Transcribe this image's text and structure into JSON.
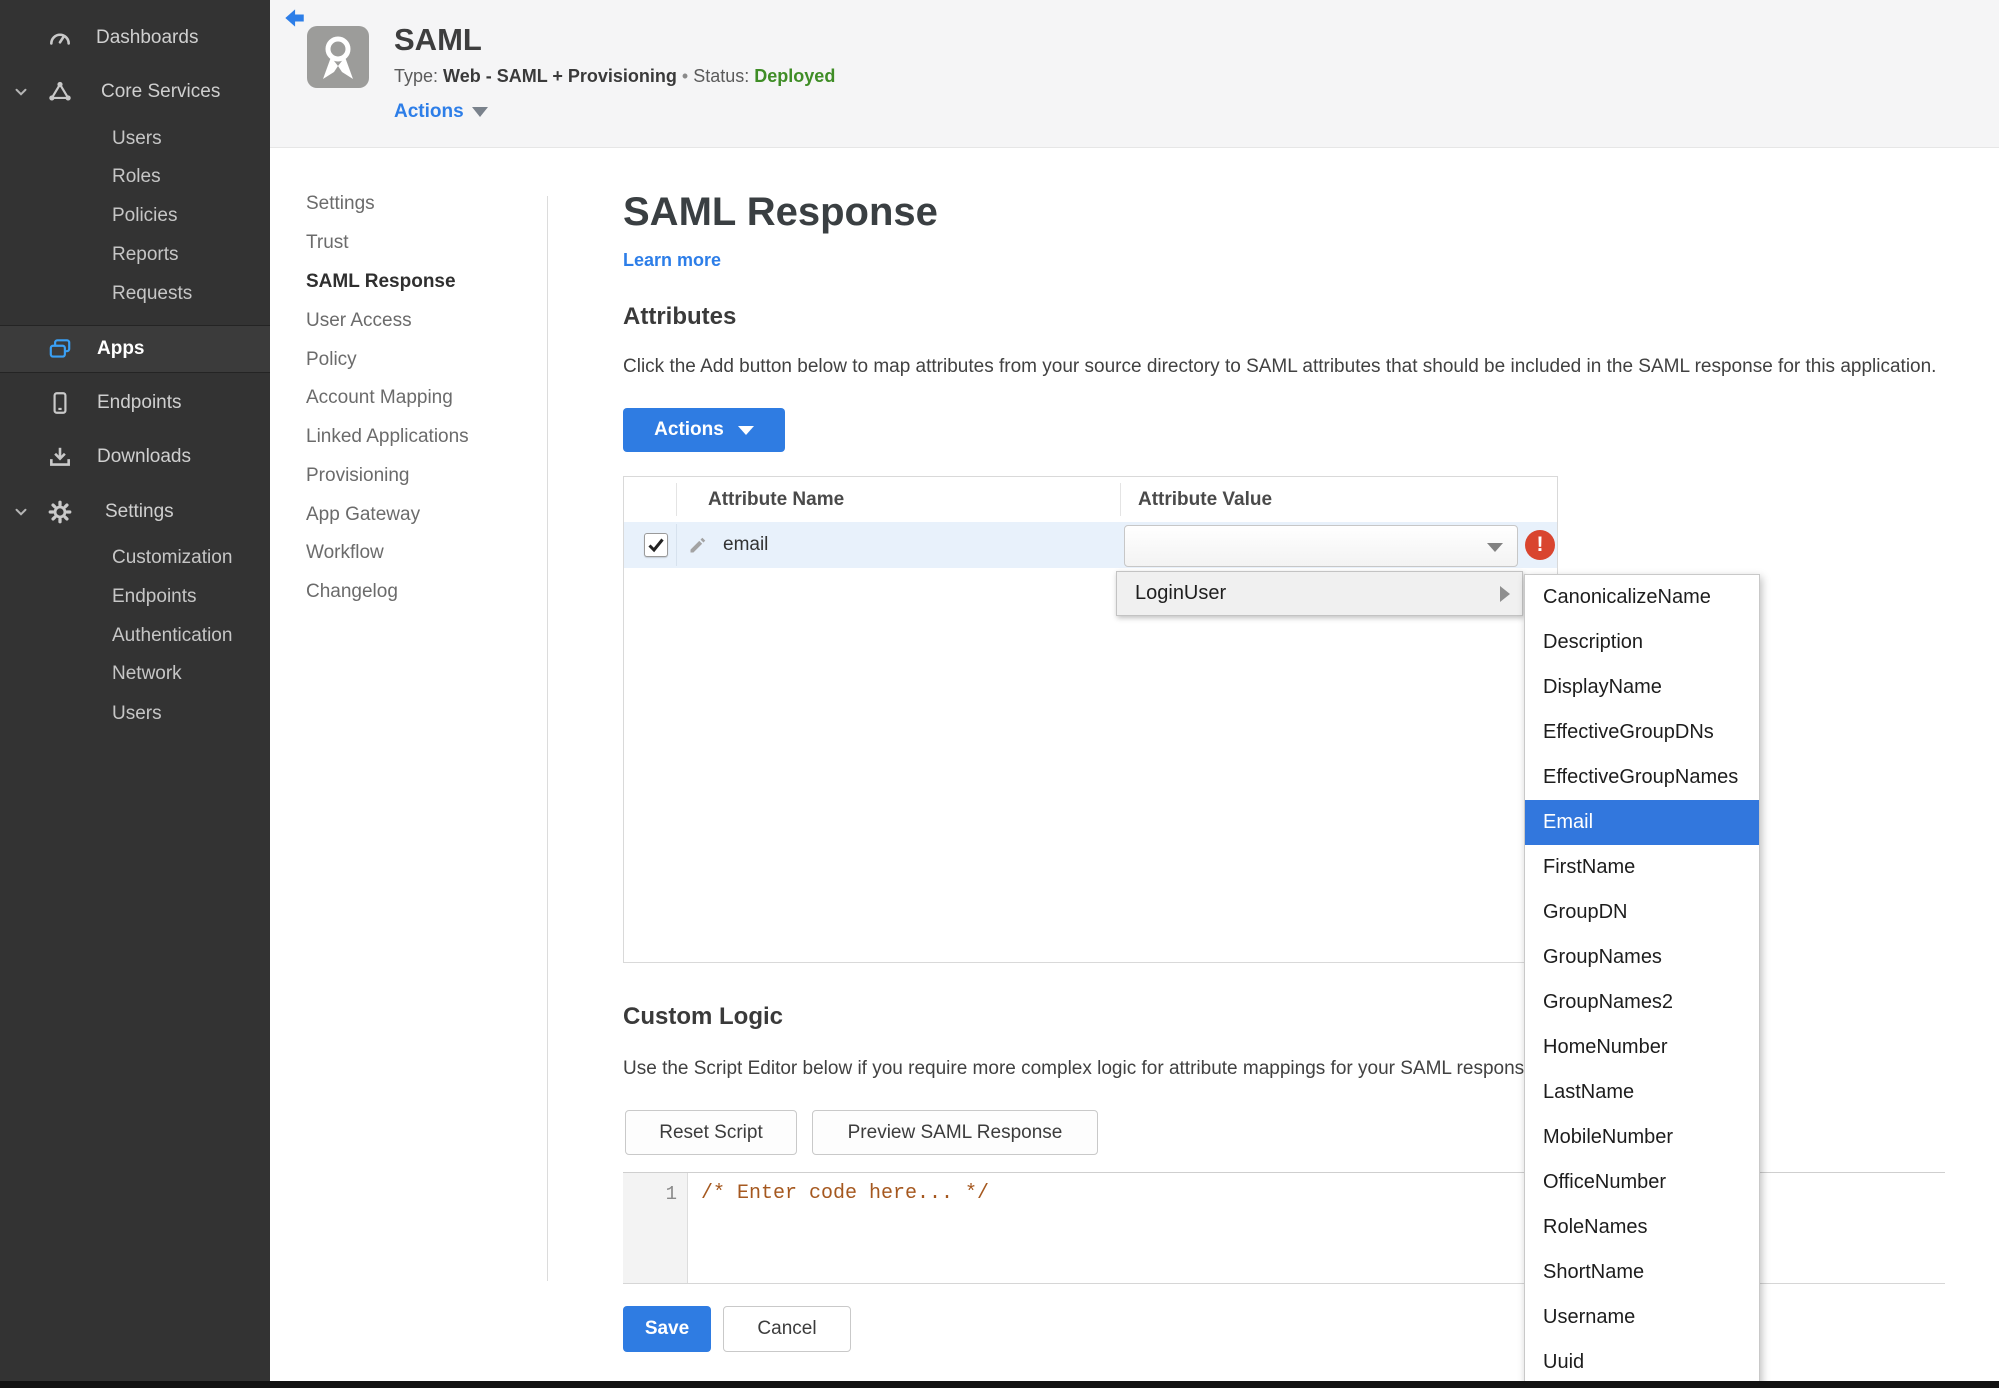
{
  "colors": {
    "accent_blue": "#2f7ce2",
    "status_green": "#3f8d26",
    "error_red": "#d9452f",
    "selection_blue": "#3277dd",
    "sidebar_bg": "#333333"
  },
  "sidebar": {
    "items": [
      {
        "label": "Dashboards"
      },
      {
        "label": "Core Services"
      },
      {
        "label": "Users"
      },
      {
        "label": "Roles"
      },
      {
        "label": "Policies"
      },
      {
        "label": "Reports"
      },
      {
        "label": "Requests"
      },
      {
        "label": "Apps"
      },
      {
        "label": "Endpoints"
      },
      {
        "label": "Downloads"
      },
      {
        "label": "Settings"
      },
      {
        "label": "Customization"
      },
      {
        "label": "Endpoints"
      },
      {
        "label": "Authentication"
      },
      {
        "label": "Network"
      },
      {
        "label": "Users"
      }
    ]
  },
  "header": {
    "app_title": "SAML",
    "type_label": "Type:",
    "type_value": "Web - SAML + Provisioning",
    "separator": "•",
    "status_label": "Status:",
    "status_value": "Deployed",
    "actions_label": "Actions"
  },
  "subnav": {
    "items": [
      {
        "label": "Settings"
      },
      {
        "label": "Trust"
      },
      {
        "label": "SAML Response"
      },
      {
        "label": "User Access"
      },
      {
        "label": "Policy"
      },
      {
        "label": "Account Mapping"
      },
      {
        "label": "Linked Applications"
      },
      {
        "label": "Provisioning"
      },
      {
        "label": "App Gateway"
      },
      {
        "label": "Workflow"
      },
      {
        "label": "Changelog"
      }
    ]
  },
  "main": {
    "title": "SAML Response",
    "learn_more": "Learn more",
    "attributes": {
      "heading": "Attributes",
      "description": "Click the Add button below to map attributes from your source directory to SAML attributes that should be included in the SAML response for this application.",
      "actions_button": "Actions",
      "table": {
        "col_name": "Attribute Name",
        "col_value": "Attribute Value",
        "rows": [
          {
            "name": "email",
            "checked": true,
            "value": ""
          }
        ]
      }
    },
    "custom_logic": {
      "heading": "Custom Logic",
      "description": "Use the Script Editor below if you require more complex logic for attribute mappings for your SAML response.",
      "reset_button": "Reset Script",
      "preview_button": "Preview SAML Response",
      "editor": {
        "line_number": "1",
        "code": "/* Enter code here... */"
      }
    },
    "footer": {
      "save": "Save",
      "cancel": "Cancel"
    }
  },
  "value_menu": {
    "root": "LoginUser",
    "selected": "Email",
    "items": [
      "CanonicalizeName",
      "Description",
      "DisplayName",
      "EffectiveGroupDNs",
      "EffectiveGroupNames",
      "Email",
      "FirstName",
      "GroupDN",
      "GroupNames",
      "GroupNames2",
      "HomeNumber",
      "LastName",
      "MobileNumber",
      "OfficeNumber",
      "RoleNames",
      "ShortName",
      "Username",
      "Uuid"
    ]
  }
}
